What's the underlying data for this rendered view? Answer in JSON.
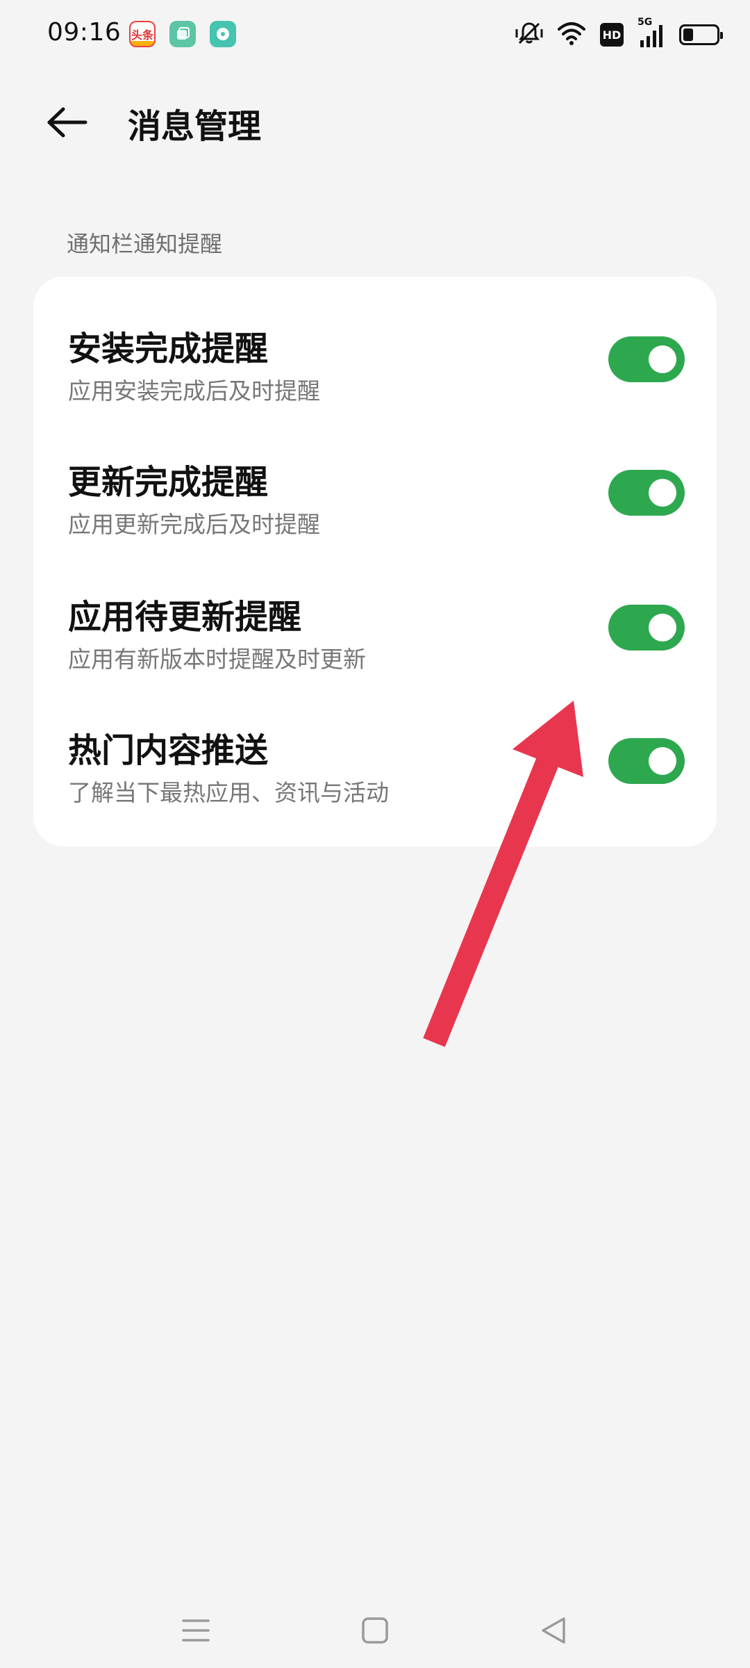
{
  "status_bar": {
    "time": "09:16",
    "notification_icons": [
      "toutiao-app-icon",
      "notes-app-icon",
      "music-app-icon"
    ],
    "toutiao_label": "头条",
    "hd_label": "HD",
    "network_label": "5G",
    "battery_level": 0.3
  },
  "header": {
    "title": "消息管理"
  },
  "section": {
    "label": "通知栏通知提醒"
  },
  "settings": [
    {
      "title": "安装完成提醒",
      "subtitle": "应用安装完成后及时提醒",
      "enabled": true
    },
    {
      "title": "更新完成提醒",
      "subtitle": "应用更新完成后及时提醒",
      "enabled": true
    },
    {
      "title": "应用待更新提醒",
      "subtitle": "应用有新版本时提醒及时更新",
      "enabled": true
    },
    {
      "title": "热门内容推送",
      "subtitle": "了解当下最热应用、资讯与活动",
      "enabled": true
    }
  ],
  "colors": {
    "toggle_on": "#2ea84f",
    "annotation_arrow": "#e8364f",
    "background": "#f4f4f4"
  },
  "nav_bar": {
    "icons": [
      "menu-icon",
      "home-icon",
      "back-triangle-icon"
    ]
  }
}
